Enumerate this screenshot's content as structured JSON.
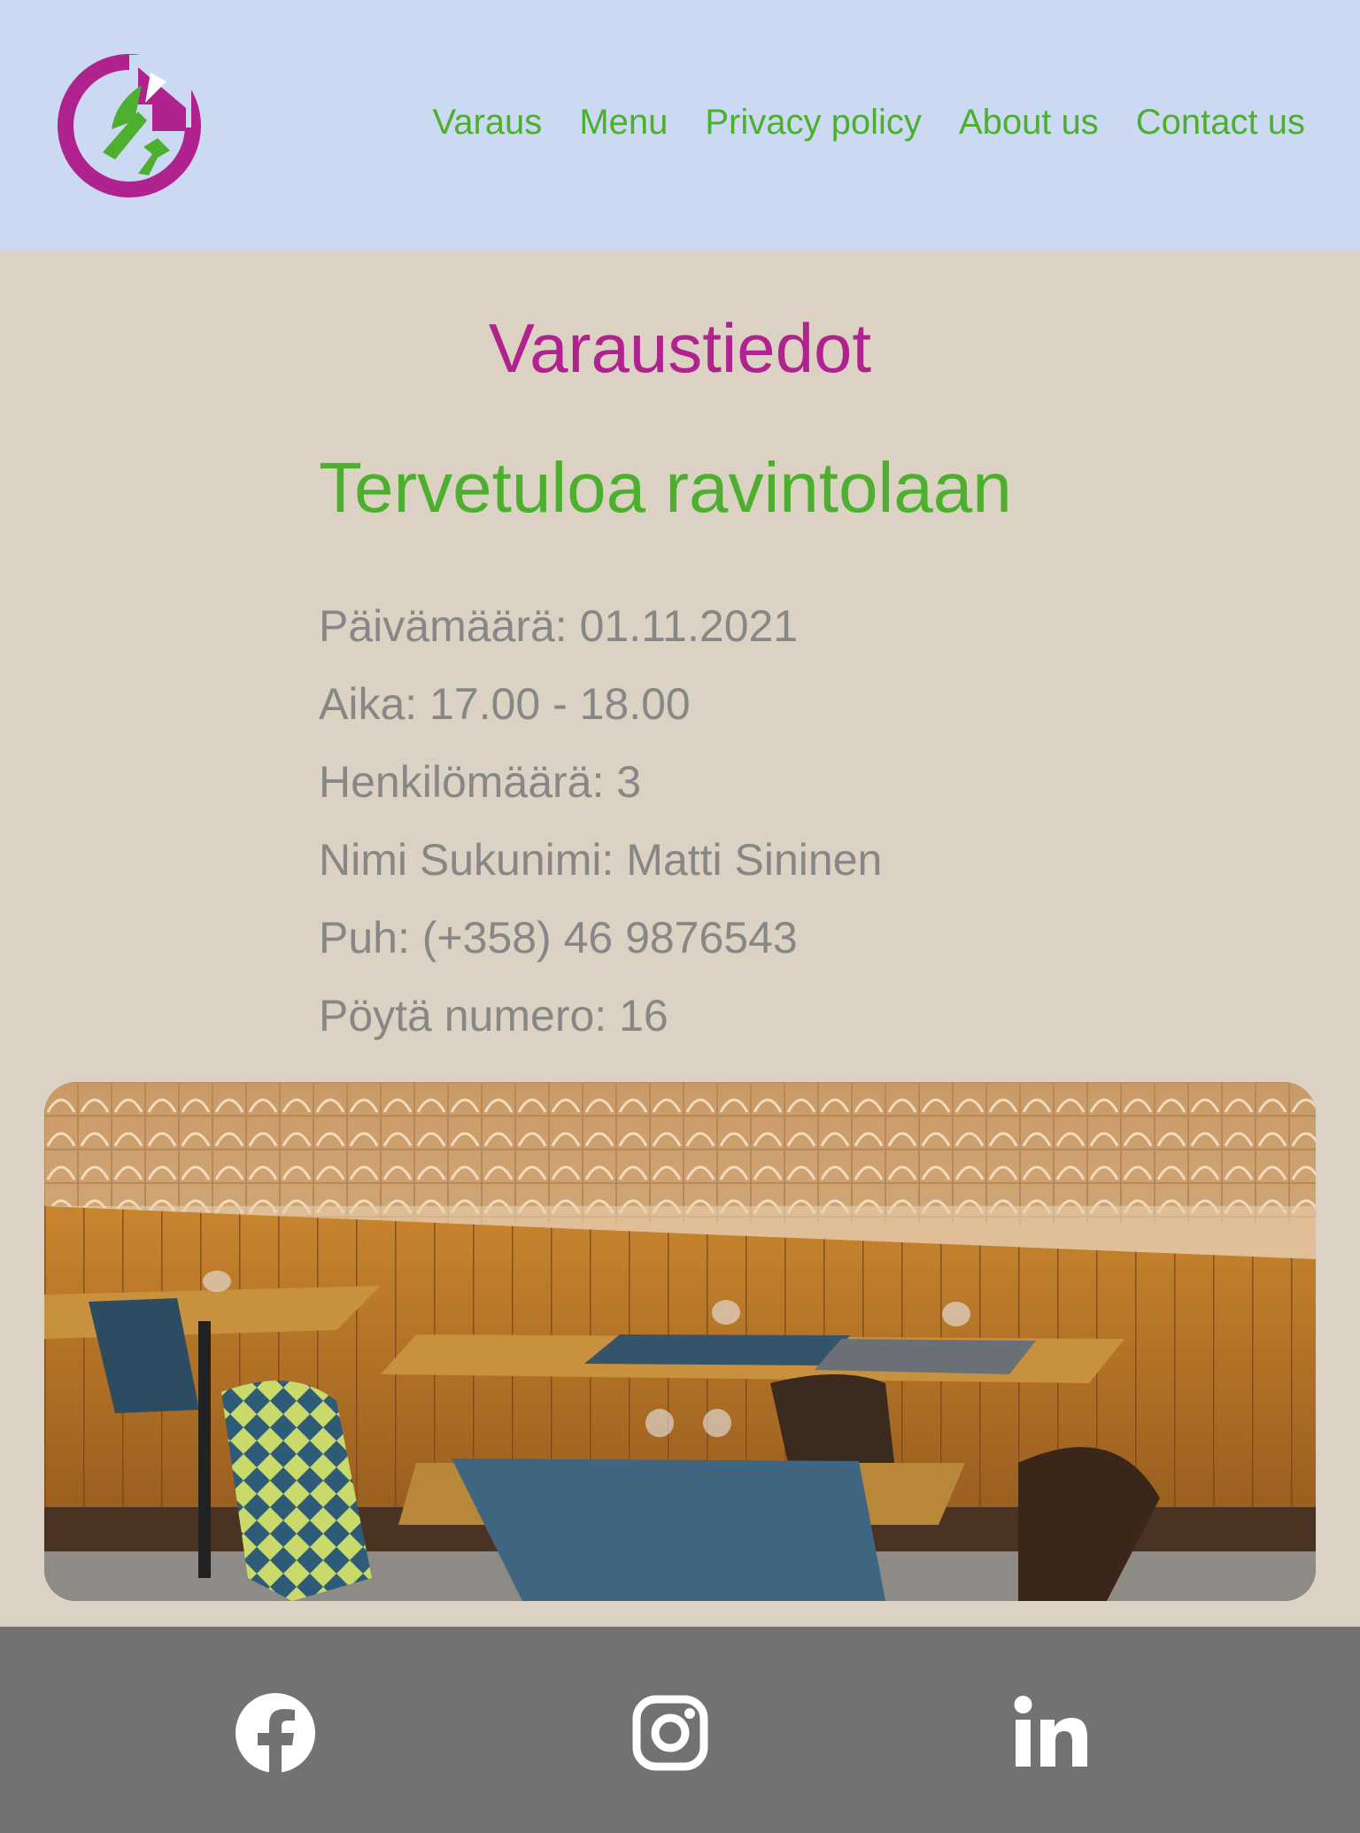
{
  "header": {
    "logo_icon": "restaurant-logo-icon",
    "nav": [
      {
        "label": "Varaus"
      },
      {
        "label": "Menu"
      },
      {
        "label": "Privacy policy"
      },
      {
        "label": "About us"
      },
      {
        "label": "Contact us"
      }
    ]
  },
  "main": {
    "title": "Varaustiedot",
    "welcome": "Tervetuloa ravintolaan",
    "details": [
      "Päivämäärä: 01.11.2021",
      "Aika: 17.00 - 18.00",
      "Henkilömäärä: 3",
      "Nimi Sukunimi: Matti Sininen",
      "Puh: (+358) 46 9876543",
      "Pöytä numero: 16"
    ]
  },
  "footer": {
    "icons": [
      "facebook-icon",
      "instagram-icon",
      "linkedin-icon"
    ]
  },
  "colors": {
    "header_bg": "#cbdaf2",
    "page_bg": "#dcd2c3",
    "accent_green": "#4caf2e",
    "accent_magenta": "#b0238e",
    "text_gray": "#878787",
    "footer_bg": "#727272"
  }
}
